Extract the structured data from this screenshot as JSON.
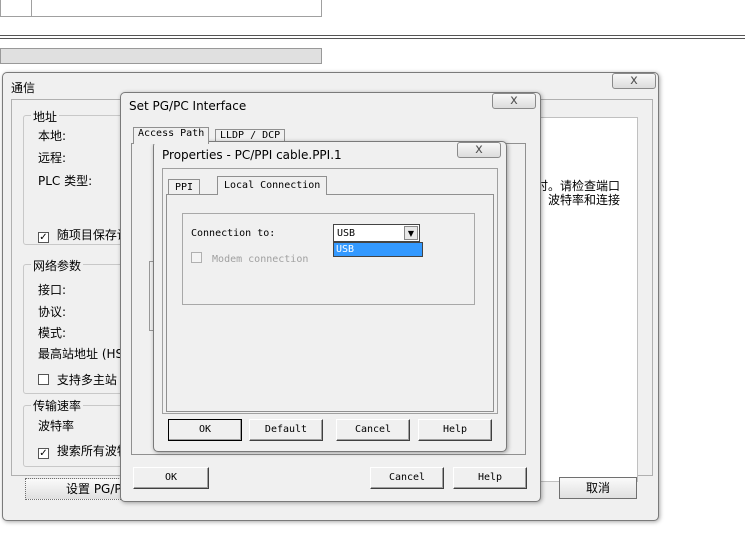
{
  "comm_dialog": {
    "title": "通信",
    "address_group": "地址",
    "local_label": "本地:",
    "remote_label": "远程:",
    "plc_type_label": "PLC 类型:",
    "save_with_project": "随项目保存设",
    "network_group": "网络参数",
    "interface_label": "接口:",
    "protocol_label": "协议:",
    "mode_label": "模式:",
    "highest_address_label": "最高站地址 (HS",
    "multi_master": "支持多主站",
    "baud_group": "传输速率",
    "baud_label": "波特率",
    "search_all_baud": "搜索所有波特",
    "setup_button": "设置 PG/PC",
    "cancel_button": "取消",
    "hint_line1": "时。请检查端口",
    "hint_line2": "、波特率和连接"
  },
  "pgpc_dialog": {
    "title": "Set PG/PC Interface",
    "tabs": [
      "Access Path",
      "LLDP / DCP"
    ],
    "ok_button": "OK",
    "cancel_button": "Cancel",
    "help_button": "Help"
  },
  "props_dialog": {
    "title": "Properties - PC/PPI cable.PPI.1",
    "tabs": [
      "PPI",
      "Local Connection"
    ],
    "connection_label": "Connection to:",
    "connection_value": "USB",
    "dropdown_options": [
      "USB"
    ],
    "modem_label": "Modem connection",
    "ok_button": "OK",
    "default_button": "Default",
    "cancel_button": "Cancel",
    "help_button": "Help"
  },
  "colors": {
    "selection": "#3399ff",
    "window_bg": "#f0f0f0"
  }
}
